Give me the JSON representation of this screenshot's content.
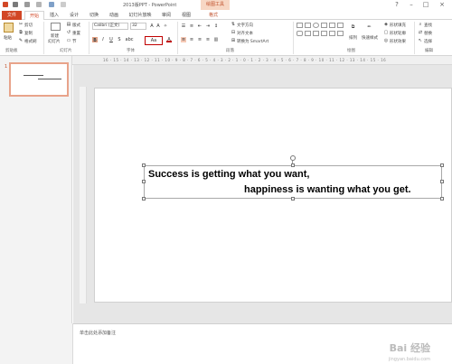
{
  "window": {
    "title": "2013版PPT - PowerPoint",
    "contextual_tool": "绘图工具",
    "controls": [
      "?",
      "–",
      "□",
      "×"
    ]
  },
  "tabs": [
    "文件",
    "开始",
    "插入",
    "设计",
    "切换",
    "动画",
    "幻灯片放映",
    "审阅",
    "视图",
    "格式"
  ],
  "ribbon": {
    "clipboard": {
      "paste": "粘贴",
      "cut": "剪切",
      "copy": "复制",
      "format_painter": "格式刷",
      "label": "剪贴板"
    },
    "slides": {
      "new_slide": "新建",
      "new_slide2": "幻灯片",
      "layout": "版式",
      "reset": "重置",
      "section": "节",
      "label": "幻灯片"
    },
    "font": {
      "family": "Calibri (正文)",
      "size": "32",
      "bold": "B",
      "italic": "I",
      "underline": "U",
      "strike": "S",
      "spacing": "abc",
      "case": "Aa",
      "color": "A",
      "label": "字体"
    },
    "paragraph": {
      "text_direction": "文字方向",
      "align_text": "对齐文本",
      "smartart": "转换为 SmartArt",
      "label": "段落"
    },
    "drawing": {
      "arrange": "排列",
      "quick_styles": "快速样式",
      "fill": "形状填充",
      "outline": "形状轮廓",
      "effects": "形状效果",
      "label": "绘图"
    },
    "editing": {
      "find": "查找",
      "replace": "替换",
      "select": "选择",
      "label": "编辑"
    }
  },
  "ruler": {
    "numbers": "16 · 15 · 14 · 13 · 12 · 11 · 10 · 9 · 8 · 7 · 6 · 5 · 4 · 3 · 2 · 1 · 0 · 1 · 2 · 3 · 4 · 5 · 6 · 7 · 8 · 9 · 10 · 11 · 12 · 13 · 14 · 15 · 16"
  },
  "thumbnail": {
    "number": "1"
  },
  "slide": {
    "line1": "Success is getting what you want,",
    "line2": "happiness is wanting what you get."
  },
  "notes": {
    "placeholder": "单击此处添加备注"
  },
  "watermark": {
    "text": "Bai 经验",
    "sub": "jingyan.baidu.com"
  },
  "colors": {
    "accent": "#d24726",
    "highlight_box": "#c00000"
  }
}
